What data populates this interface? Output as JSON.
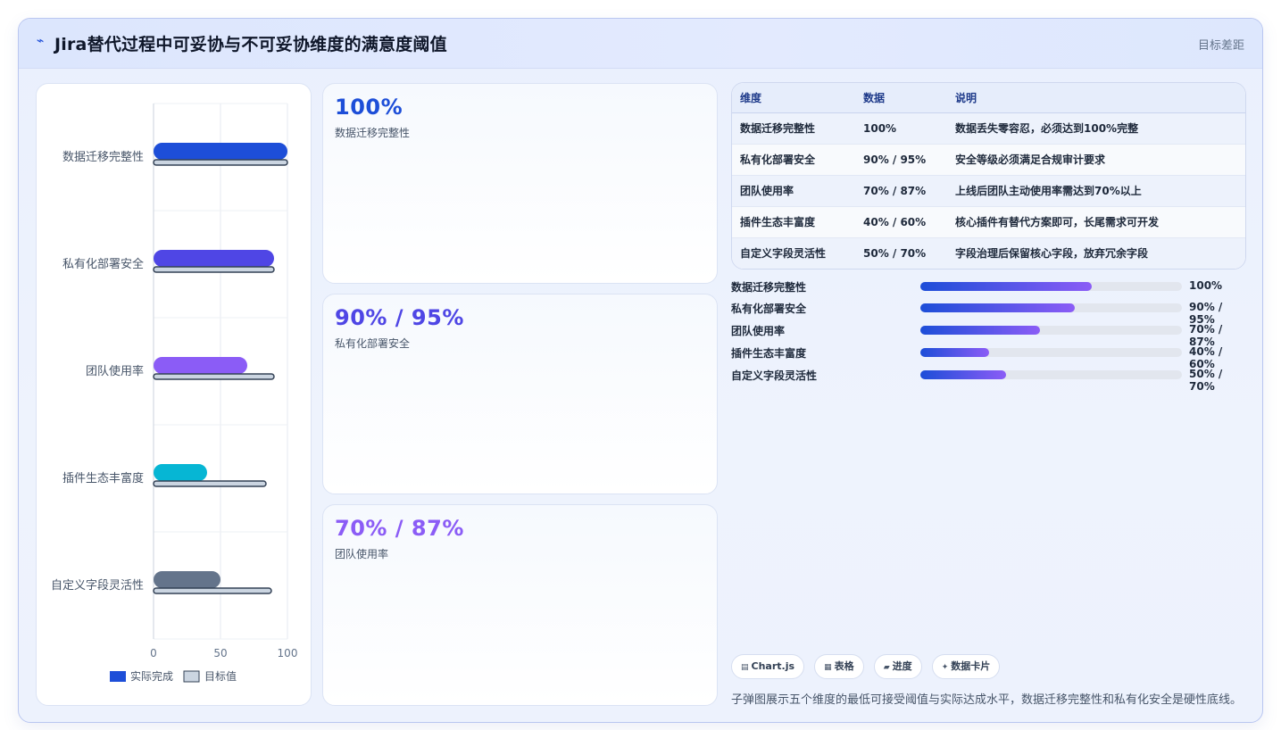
{
  "header": {
    "icon": "⌁",
    "title": "Jira替代过程中可妥协与不可妥协维度的满意度阈值",
    "right_label": "目标差距"
  },
  "chart_data": {
    "type": "bar",
    "orientation": "horizontal",
    "categories": [
      "数据迁移完整性",
      "私有化部署安全",
      "团队使用率",
      "插件生态丰富度",
      "自定义字段灵活性"
    ],
    "series": [
      {
        "name": "实际完成",
        "values": [
          100,
          90,
          70,
          40,
          50
        ],
        "colors": [
          "#1d4ed8",
          "#4f46e5",
          "#8b5cf6",
          "#06b6d4",
          "#64748b"
        ]
      },
      {
        "name": "目标值",
        "values": [
          100,
          90,
          90,
          84,
          88
        ],
        "color": "#cbd5e1",
        "stroke": "#334155"
      }
    ],
    "xlim": [
      0,
      100
    ],
    "x_ticks": [
      0,
      50,
      100
    ],
    "grid": true,
    "legend_placement": "bottom"
  },
  "legend": {
    "actual": {
      "label": "实际完成",
      "color": "#1d4ed8"
    },
    "target": {
      "label": "目标值",
      "color": "#cbd5e1"
    }
  },
  "kpis": [
    {
      "value": "100%",
      "label": "数据迁移完整性",
      "color": "#1d4ed8"
    },
    {
      "value": "90% / 95%",
      "label": "私有化部署安全",
      "color": "#4f46e5"
    },
    {
      "value": "70% / 87%",
      "label": "团队使用率",
      "color": "#8b5cf6"
    }
  ],
  "table": {
    "headers": [
      "维度",
      "数据",
      "说明"
    ],
    "rows": [
      [
        "数据迁移完整性",
        "100%",
        "数据丢失零容忍，必须达到100%完整"
      ],
      [
        "私有化部署安全",
        "90% / 95%",
        "安全等级必须满足合规审计要求"
      ],
      [
        "团队使用率",
        "70% / 87%",
        "上线后团队主动使用率需达到70%以上"
      ],
      [
        "插件生态丰富度",
        "40% / 60%",
        "核心插件有替代方案即可，长尾需求可开发"
      ],
      [
        "自定义字段灵活性",
        "50% / 70%",
        "字段治理后保留核心字段，放弃冗余字段"
      ]
    ]
  },
  "progress": [
    {
      "label": "数据迁移完整性",
      "value": "100%",
      "fill_fraction": 0.655
    },
    {
      "label": "私有化部署安全",
      "value": "90% / 95%",
      "fill_fraction": 0.59
    },
    {
      "label": "团队使用率",
      "value": "70% / 87%",
      "fill_fraction": 0.458
    },
    {
      "label": "插件生态丰富度",
      "value": "40% / 60%",
      "fill_fraction": 0.262
    },
    {
      "label": "自定义字段灵活性",
      "value": "50% / 70%",
      "fill_fraction": 0.328
    }
  ],
  "chips": [
    {
      "icon": "▤",
      "label": "Chart.js"
    },
    {
      "icon": "▦",
      "label": "表格"
    },
    {
      "icon": "▰",
      "label": "进度"
    },
    {
      "icon": "✦",
      "label": "数据卡片"
    }
  ],
  "footer_note": "子弹图展示五个维度的最低可接受阈值与实际达成水平，数据迁移完整性和私有化安全是硬性底线。"
}
